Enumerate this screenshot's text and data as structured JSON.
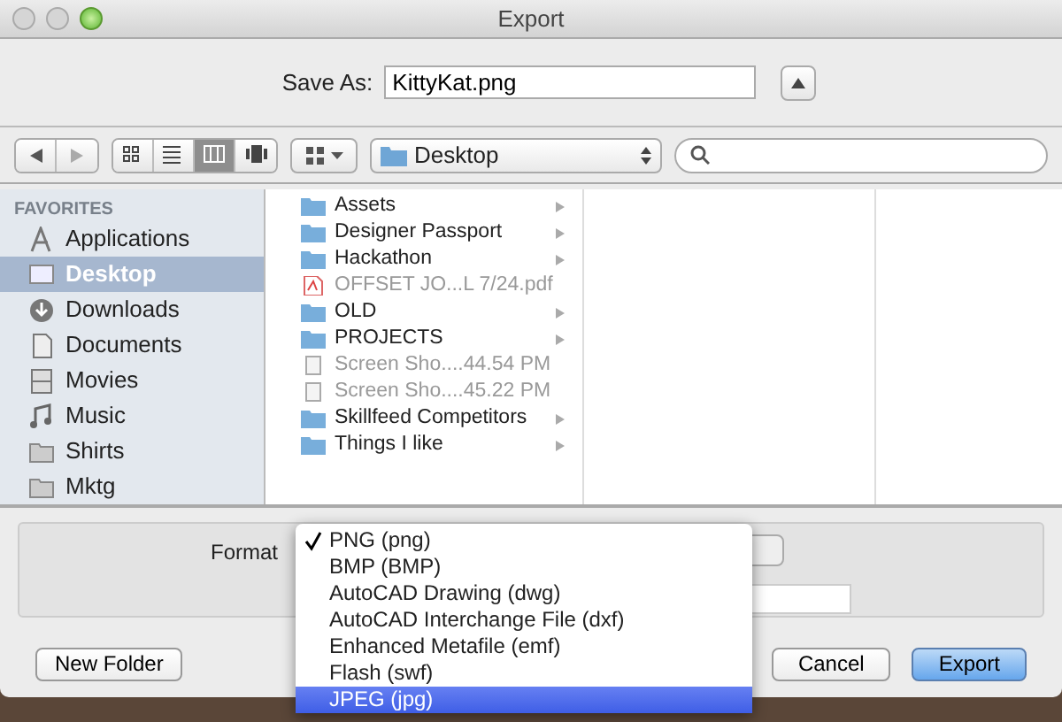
{
  "window": {
    "title": "Export"
  },
  "save_as": {
    "label": "Save As:",
    "value": "KittyKat.png"
  },
  "toolbar": {
    "view_modes": [
      {
        "kind": "icons",
        "selected": false
      },
      {
        "kind": "list",
        "selected": false
      },
      {
        "kind": "columns",
        "selected": true
      },
      {
        "kind": "coverflow",
        "selected": false
      }
    ],
    "location": "Desktop"
  },
  "sidebar": {
    "heading": "FAVORITES",
    "items": [
      {
        "kind": "applications",
        "label": "Applications",
        "selected": false
      },
      {
        "kind": "desktop",
        "label": "Desktop",
        "selected": true
      },
      {
        "kind": "downloads",
        "label": "Downloads",
        "selected": false
      },
      {
        "kind": "documents",
        "label": "Documents",
        "selected": false
      },
      {
        "kind": "movies",
        "label": "Movies",
        "selected": false
      },
      {
        "kind": "music",
        "label": "Music",
        "selected": false
      },
      {
        "kind": "folder",
        "label": "Shirts",
        "selected": false
      },
      {
        "kind": "folder",
        "label": "Mktg",
        "selected": false
      }
    ]
  },
  "files": [
    {
      "kind": "folder",
      "name": "Assets",
      "disabled": false
    },
    {
      "kind": "folder",
      "name": "Designer Passport",
      "disabled": false
    },
    {
      "kind": "folder",
      "name": "Hackathon",
      "disabled": false
    },
    {
      "kind": "pdf",
      "name": "OFFSET JO...L 7/24.pdf",
      "disabled": true
    },
    {
      "kind": "folder",
      "name": "OLD",
      "disabled": false
    },
    {
      "kind": "folder",
      "name": "PROJECTS",
      "disabled": false
    },
    {
      "kind": "image",
      "name": "Screen Sho....44.54 PM",
      "disabled": true
    },
    {
      "kind": "image",
      "name": "Screen Sho....45.22 PM",
      "disabled": true
    },
    {
      "kind": "folder",
      "name": "Skillfeed Competitors",
      "disabled": false
    },
    {
      "kind": "folder",
      "name": "Things I like",
      "disabled": false
    }
  ],
  "format": {
    "label": "Format",
    "menu": [
      {
        "label": "PNG (png)",
        "checked": true,
        "selected": false
      },
      {
        "label": "BMP (BMP)",
        "checked": false,
        "selected": false
      },
      {
        "label": "AutoCAD Drawing (dwg)",
        "checked": false,
        "selected": false
      },
      {
        "label": "AutoCAD Interchange File (dxf)",
        "checked": false,
        "selected": false
      },
      {
        "label": "Enhanced Metafile (emf)",
        "checked": false,
        "selected": false
      },
      {
        "label": "Flash (swf)",
        "checked": false,
        "selected": false
      },
      {
        "label": "JPEG (jpg)",
        "checked": false,
        "selected": true
      }
    ]
  },
  "buttons": {
    "new_folder": "New Folder",
    "cancel": "Cancel",
    "export": "Export"
  }
}
